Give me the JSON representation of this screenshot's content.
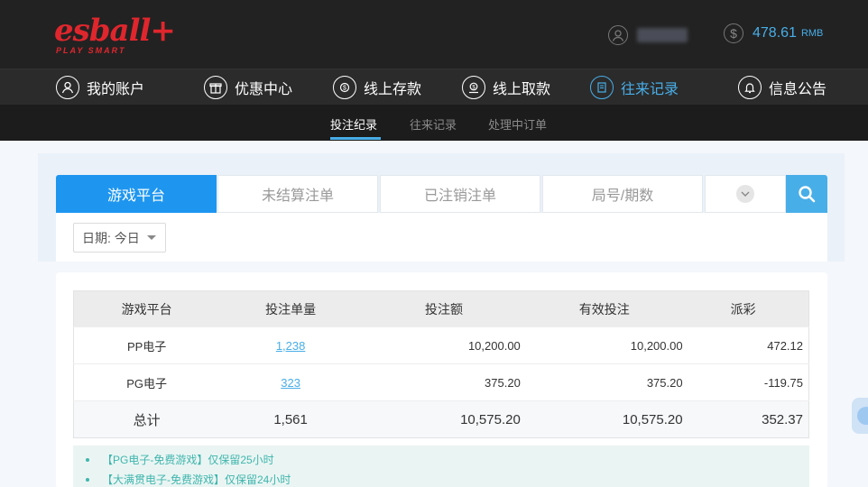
{
  "brand": {
    "logo": "esball+",
    "tagline": "PLAY SMART",
    "color": "#e0262d"
  },
  "account": {
    "balance": "478.61",
    "currency": "RMB"
  },
  "nav": [
    {
      "label": "我的账户",
      "icon": "user-icon"
    },
    {
      "label": "优惠中心",
      "icon": "gift-icon"
    },
    {
      "label": "线上存款",
      "icon": "deposit-icon"
    },
    {
      "label": "线上取款",
      "icon": "withdraw-icon"
    },
    {
      "label": "往来记录",
      "icon": "records-icon",
      "active": true
    },
    {
      "label": "信息公告",
      "icon": "bell-icon"
    }
  ],
  "subnav": [
    {
      "label": "投注纪录",
      "active": true
    },
    {
      "label": "往来记录"
    },
    {
      "label": "处理中订单"
    }
  ],
  "tabs": [
    {
      "label": "游戏平台",
      "active": true
    },
    {
      "label": "未结算注单"
    },
    {
      "label": "已注销注单"
    },
    {
      "label": "局号/期数"
    }
  ],
  "filter": {
    "date_label": "日期: 今日"
  },
  "table": {
    "headers": [
      "游戏平台",
      "投注单量",
      "投注额",
      "有效投注",
      "派彩"
    ],
    "rows": [
      {
        "platform": "PP电子",
        "count": "1,238",
        "bet": "10,200.00",
        "valid": "10,200.00",
        "payout": "472.12"
      },
      {
        "platform": "PG电子",
        "count": "323",
        "bet": "375.20",
        "valid": "375.20",
        "payout": "-119.75"
      }
    ],
    "total": {
      "label": "总计",
      "count": "1,561",
      "bet": "10,575.20",
      "valid": "10,575.20",
      "payout": "352.37"
    }
  },
  "notes": [
    "【PG电子-免费游戏】仅保留25小时",
    "【大满贯电子-免费游戏】仅保留24小时"
  ],
  "colors": {
    "accent": "#48aee8",
    "tab_active": "#1e96f0",
    "negative": "#e0506b",
    "note": "#3fb5ad"
  }
}
